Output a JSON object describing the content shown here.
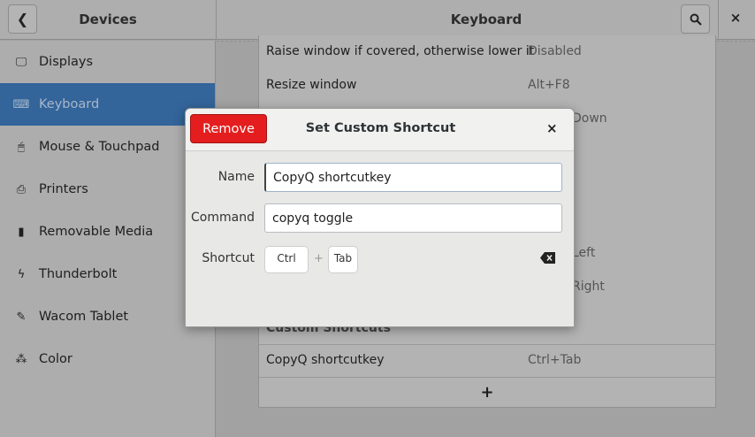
{
  "header": {
    "left_title": "Devices",
    "right_title": "Keyboard",
    "close": "×"
  },
  "sidebar": {
    "items": [
      {
        "label": "Displays",
        "icon": "display-icon"
      },
      {
        "label": "Keyboard",
        "icon": "keyboard-icon",
        "selected": true
      },
      {
        "label": "Mouse & Touchpad",
        "icon": "mouse-icon"
      },
      {
        "label": "Printers",
        "icon": "printer-icon"
      },
      {
        "label": "Removable Media",
        "icon": "usb-icon"
      },
      {
        "label": "Thunderbolt",
        "icon": "thunderbolt-icon"
      },
      {
        "label": "Wacom Tablet",
        "icon": "tablet-icon"
      },
      {
        "label": "Color",
        "icon": "color-icon"
      }
    ]
  },
  "shortcuts": {
    "rows": [
      {
        "name": "Raise window if covered, otherwise lower it",
        "value": "Disabled"
      },
      {
        "name": "Resize window",
        "value": "Alt+F8"
      },
      {
        "name": "",
        "value": "Down"
      },
      {
        "name": "",
        "value": "Left"
      },
      {
        "name": "",
        "value": "Right"
      }
    ],
    "custom_heading": "Custom Shortcuts",
    "custom": {
      "name": "CopyQ shortcutkey",
      "value": "Ctrl+Tab"
    },
    "add": "+"
  },
  "dialog": {
    "title": "Set Custom Shortcut",
    "remove": "Remove",
    "close": "×",
    "name_label": "Name",
    "name_value": "CopyQ shortcutkey",
    "command_label": "Command",
    "command_value": "copyq toggle",
    "shortcut_label": "Shortcut",
    "keys": [
      "Ctrl",
      "Tab"
    ],
    "plus": "+"
  },
  "colors": {
    "accent": "#33649a",
    "destructive": "#e41e1e"
  }
}
